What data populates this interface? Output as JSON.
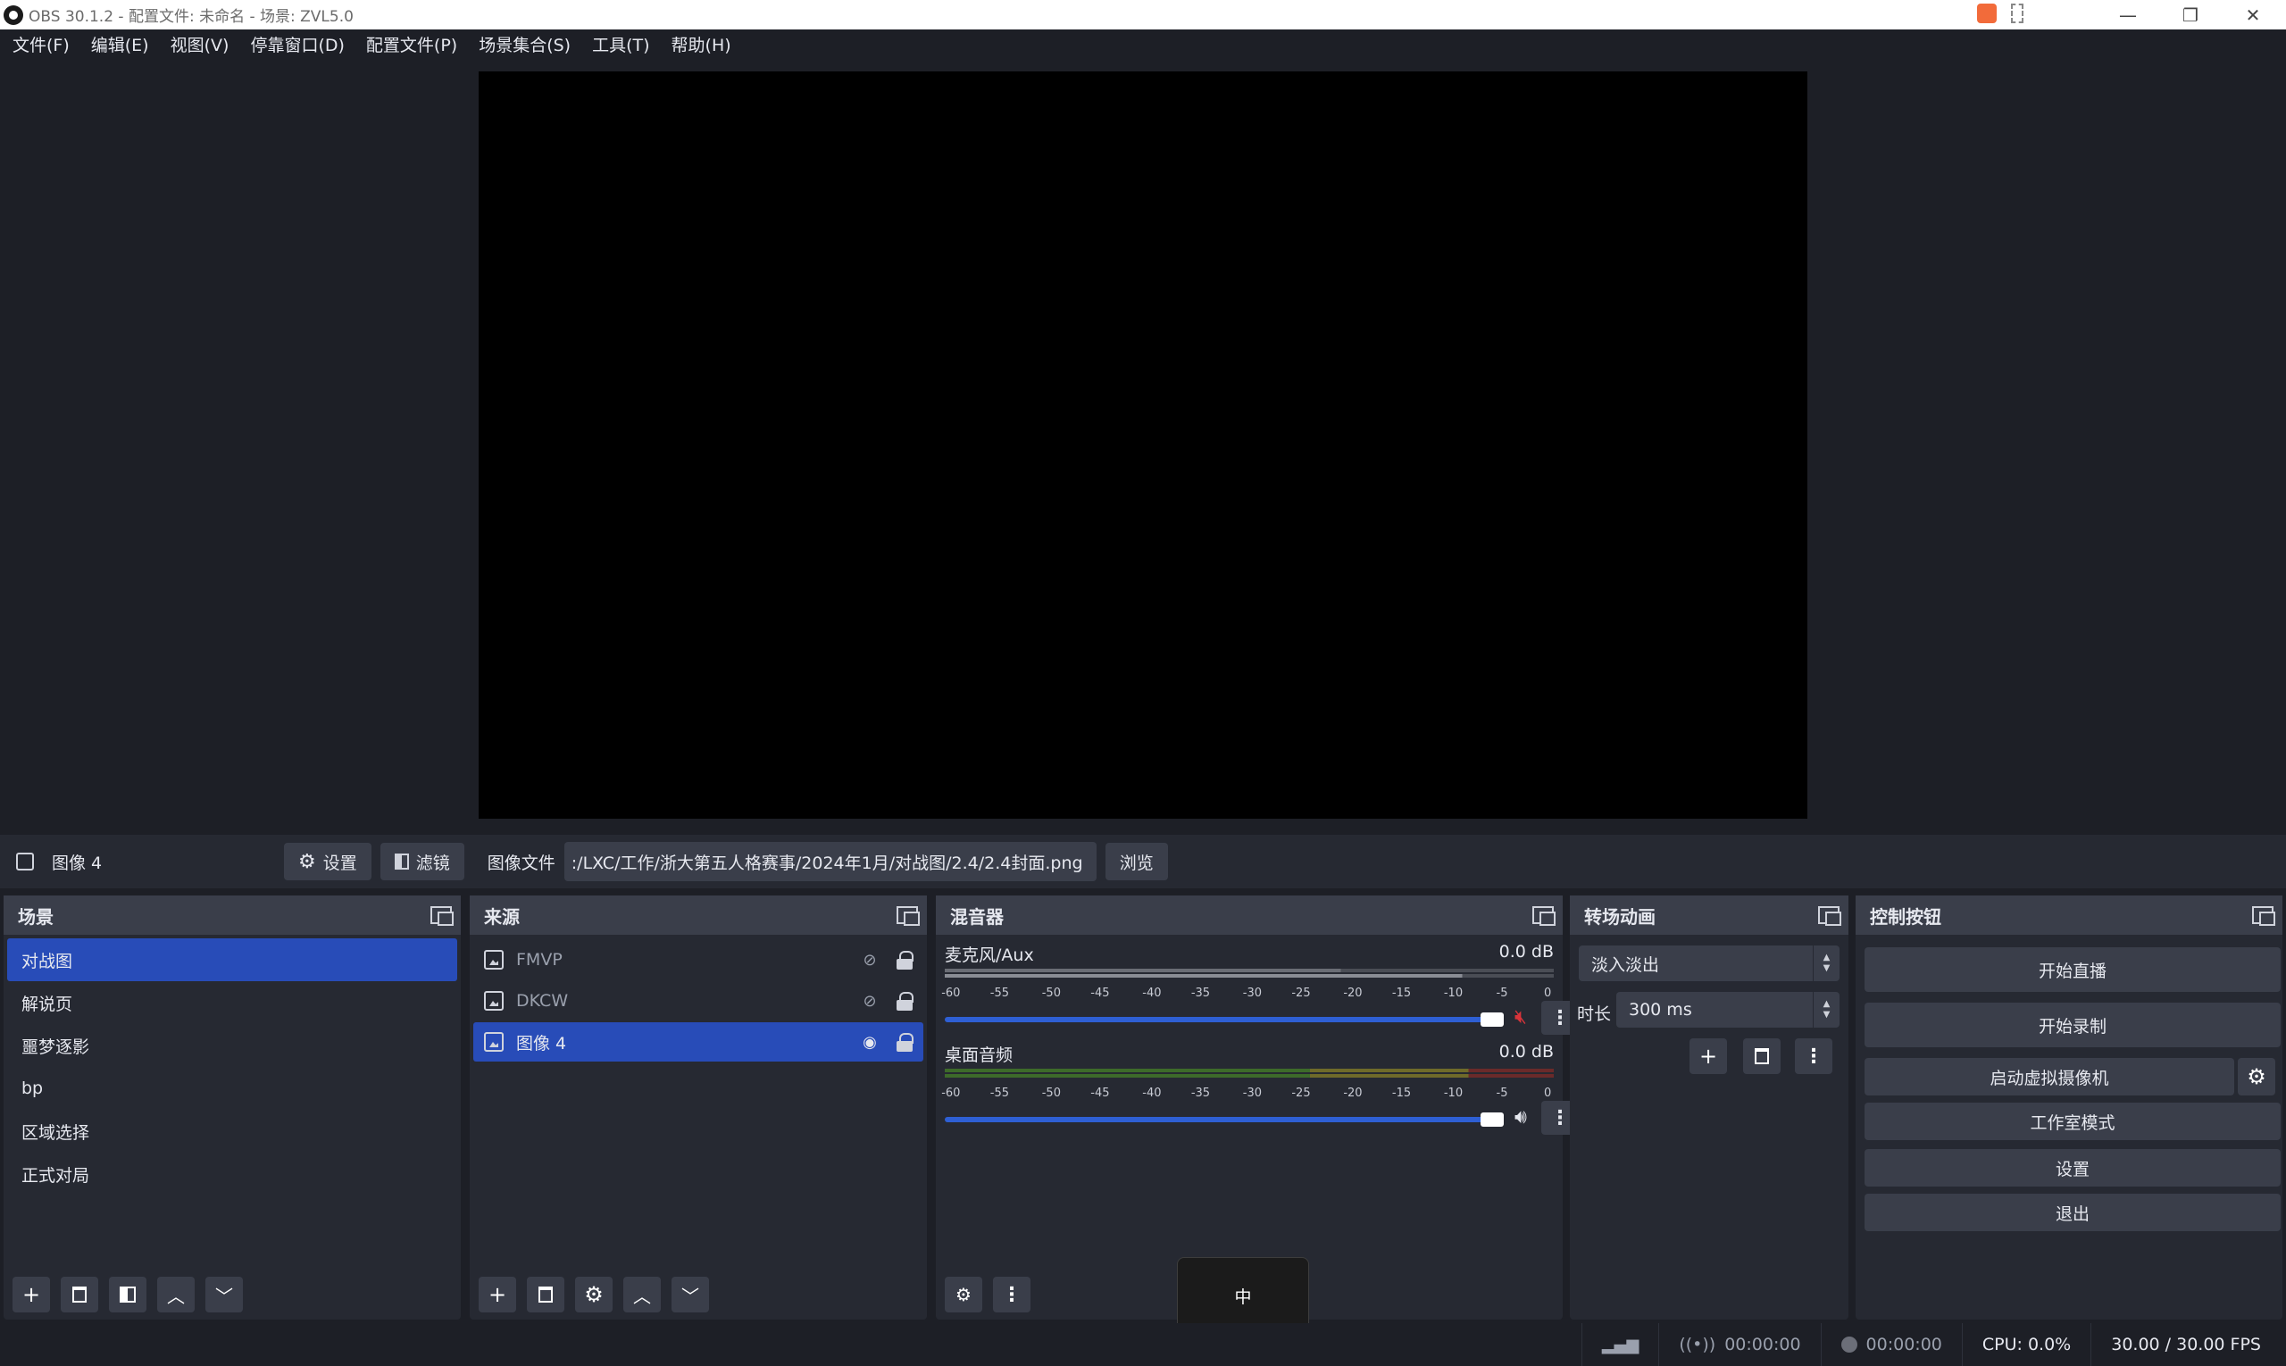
{
  "window": {
    "title": "OBS 30.1.2 - 配置文件: 未命名 - 场景: ZVL5.0"
  },
  "menu": [
    "文件(F)",
    "编辑(E)",
    "视图(V)",
    "停靠窗口(D)",
    "配置文件(P)",
    "场景集合(S)",
    "工具(T)",
    "帮助(H)"
  ],
  "source_bar": {
    "selected": "图像 4",
    "settings_label": "设置",
    "filters_label": "滤镜",
    "file_label": "图像文件",
    "file_path": ":/LXC/工作/浙大第五人格赛事/2024年1月/对战图/2.4/2.4封面.png",
    "browse_label": "浏览"
  },
  "scenes": {
    "title": "场景",
    "items": [
      "对战图",
      "解说页",
      "噩梦逐影",
      "bp",
      "区域选择",
      "正式对局"
    ],
    "selected_index": 0
  },
  "sources": {
    "title": "来源",
    "items": [
      {
        "name": "FMVP",
        "visible": false
      },
      {
        "name": "DKCW",
        "visible": false
      },
      {
        "name": "图像 4",
        "visible": true
      }
    ]
  },
  "mixer": {
    "title": "混音器",
    "scale": [
      "-60",
      "-55",
      "-50",
      "-45",
      "-40",
      "-35",
      "-30",
      "-25",
      "-20",
      "-15",
      "-10",
      "-5",
      "0"
    ],
    "channels": [
      {
        "name": "麦克风/Aux",
        "db": "0.0 dB",
        "muted": true,
        "volume_pct": 100
      },
      {
        "name": "桌面音频",
        "db": "0.0 dB",
        "muted": false,
        "volume_pct": 100
      }
    ]
  },
  "transitions": {
    "title": "转场动画",
    "selected": "淡入淡出",
    "duration_label": "时长",
    "duration": "300 ms"
  },
  "controls": {
    "title": "控制按钮",
    "buttons": [
      "开始直播",
      "开始录制",
      "启动虚拟摄像机",
      "工作室模式",
      "设置",
      "退出"
    ]
  },
  "status": {
    "stream_time": "00:00:00",
    "record_time": "00:00:00",
    "cpu": "CPU: 0.0%",
    "fps": "30.00 / 30.00 FPS"
  },
  "ime": {
    "label": "中"
  },
  "colors": {
    "accent": "#284cb8",
    "mute": "#d9343a",
    "bg": "#1d1f26",
    "panel": "#262932"
  }
}
